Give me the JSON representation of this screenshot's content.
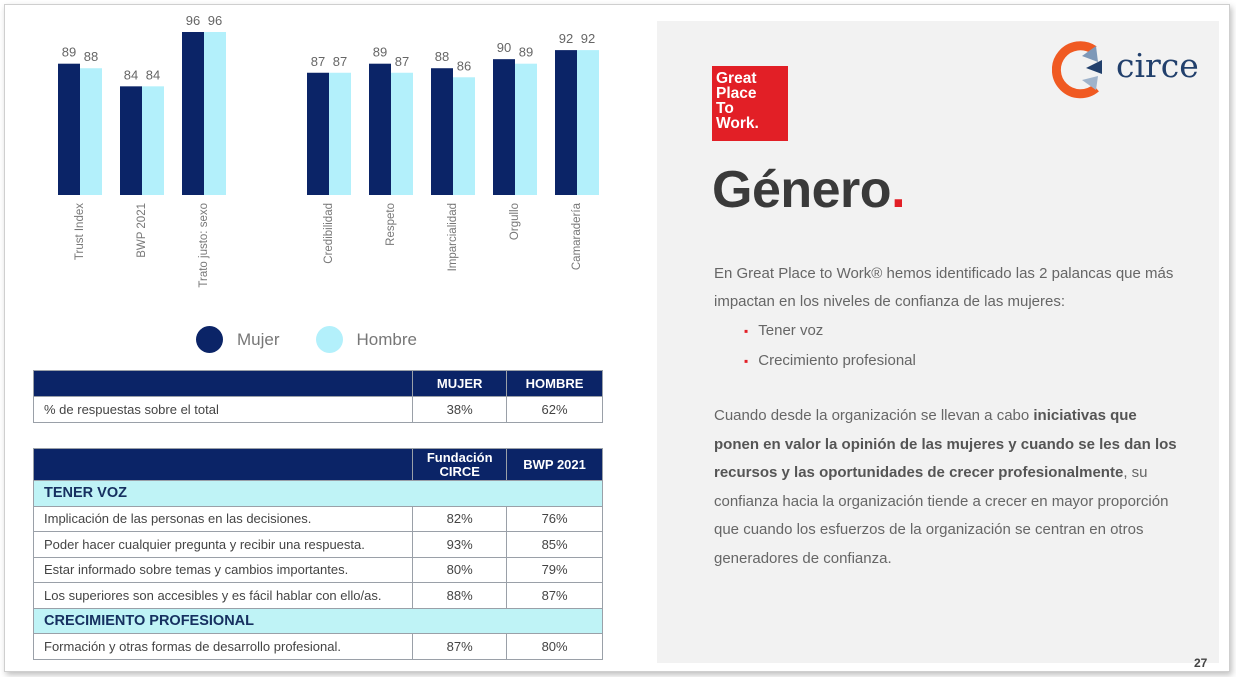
{
  "colors": {
    "mujer": "#0b2467",
    "hombre": "#b3f0fb",
    "accent_red": "#e21f26",
    "table_header": "#0b2467",
    "section_bg": "#bff3f6"
  },
  "chart_data": {
    "type": "bar",
    "categories": [
      "Trust Index",
      "BWP 2021",
      "Trato justo: sexo",
      "Credibilidad",
      "Respeto",
      "Imparcialidad",
      "Orgullo",
      "Camaradería"
    ],
    "series": [
      {
        "name": "Mujer",
        "values": [
          89,
          84,
          96,
          87,
          89,
          88,
          90,
          92
        ]
      },
      {
        "name": "Hombre",
        "values": [
          88,
          84,
          96,
          87,
          87,
          86,
          89,
          92
        ]
      }
    ],
    "data_labels": true,
    "legend": [
      "Mujer",
      "Hombre"
    ],
    "legend_position": "bottom",
    "grid": false
  },
  "table_share": {
    "headers": [
      "",
      "MUJER",
      "HOMBRE"
    ],
    "rows": [
      {
        "label": "% de respuestas sobre el total",
        "mujer": "38%",
        "hombre": "62%"
      }
    ]
  },
  "table_levers": {
    "headers": [
      "",
      "Fundación CIRCE",
      "BWP 2021"
    ],
    "sections": [
      {
        "title": "TENER VOZ",
        "rows": [
          {
            "label": "Implicación de las personas en las decisiones.",
            "circe": "82%",
            "bwp": "76%"
          },
          {
            "label": "Poder hacer cualquier pregunta y recibir una respuesta.",
            "circe": "93%",
            "bwp": "85%"
          },
          {
            "label": "Estar informado sobre temas y cambios importantes.",
            "circe": "80%",
            "bwp": "79%"
          },
          {
            "label": "Los superiores son accesibles y es fácil hablar con ello/as.",
            "circe": "88%",
            "bwp": "87%"
          }
        ]
      },
      {
        "title": "CRECIMIENTO PROFESIONAL",
        "rows": [
          {
            "label": "Formación y otras formas de desarrollo profesional.",
            "circe": "87%",
            "bwp": "80%"
          }
        ]
      }
    ]
  },
  "panel": {
    "gptw_logo": [
      "Great",
      "Place",
      "To",
      "Work."
    ],
    "circe_logo": "circe",
    "title": "Género",
    "title_dot": ".",
    "intro": "En Great Place to Work® hemos identificado las 2 palancas que más impactan en los niveles de confianza de las mujeres:",
    "bullets": [
      "Tener voz",
      "Crecimiento profesional"
    ],
    "body_pre": "Cuando desde la organización se llevan a cabo ",
    "body_bold": "iniciativas que ponen en valor la opinión de las mujeres y cuando se les dan los recursos y las oportunidades de crecer profesionalmente",
    "body_post": ", su confianza hacia la organización tiende a crecer en mayor proporción que cuando los esfuerzos de la organización se centran en otros generadores de confianza."
  },
  "page_number": "27"
}
